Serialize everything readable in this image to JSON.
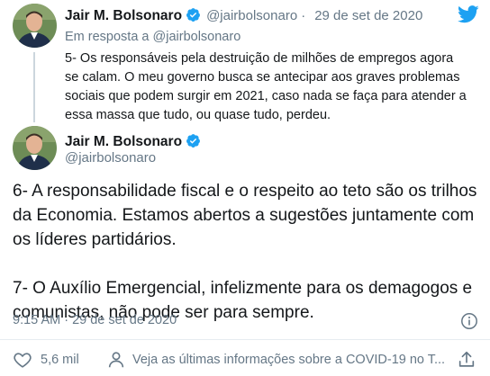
{
  "parent_tweet": {
    "author_name": "Jair M. Bolsonaro",
    "handle": "@jairbolsonaro",
    "separator": "·",
    "date": "29 de set de 2020",
    "reply_context": "Em resposta a @jairbolsonaro",
    "text": "5- Os responsáveis pela destruição de milhões de empregos agora se calam. O meu governo busca se antecipar aos graves problemas sociais que podem surgir em 2021, caso nada se faça para atender a essa massa que tudo, ou quase tudo, perdeu."
  },
  "main_tweet": {
    "author_name": "Jair M. Bolsonaro",
    "handle": "@jairbolsonaro",
    "text": "6- A responsabilidade fiscal e o respeito ao teto são os trilhos da Economia. Estamos abertos a sugestões juntamente com os líderes partidários.\n\n7- O Auxílio Emergencial, infelizmente para os demagogos e comunistas, não pode ser para sempre.",
    "timestamp": "9:15 AM · 29 de set de 2020"
  },
  "actions": {
    "likes_count": "5,6 mil",
    "cta_text": "Veja as últimas informações sobre a COVID-19 no T..."
  },
  "icons": {
    "logo": "twitter-bird-icon",
    "verified": "verified-badge-icon",
    "info": "info-icon",
    "like": "heart-icon",
    "cta": "person-icon",
    "share": "share-icon"
  },
  "colors": {
    "brand": "#1da1f2",
    "text": "#14171a",
    "secondary": "#657786",
    "line": "#ccd6dd"
  }
}
